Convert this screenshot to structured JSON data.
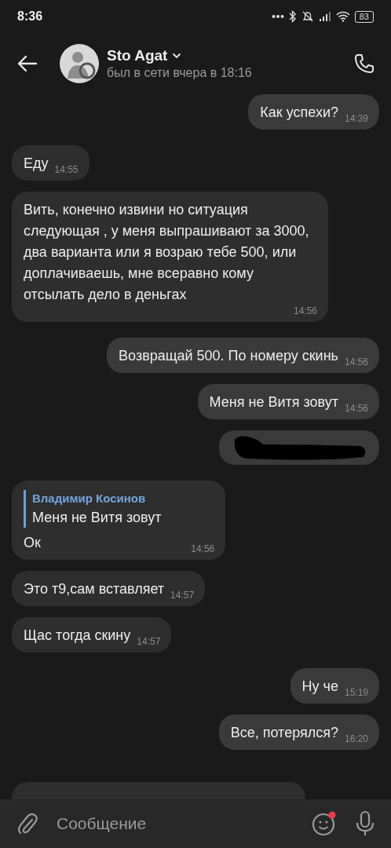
{
  "status_bar": {
    "time": "8:36",
    "battery": "83"
  },
  "header": {
    "name": "Sto Agat",
    "status": "был в сети вчера в 18:16"
  },
  "messages": [
    {
      "kind": "out",
      "text": "Как успехи?",
      "time": "14:39"
    },
    {
      "kind": "in",
      "text": "Еду",
      "time": "14:55"
    },
    {
      "kind": "in",
      "text": "Вить, конечно извини но ситуация следующая , у меня выпрашивают за 3000, два варианта или я возраю тебе 500, или доплачиваешь, мне всеравно кому отсылать дело  в деньгах",
      "time": "14:56"
    },
    {
      "kind": "out",
      "text": "Возвращай 500. По номеру скинь",
      "time": "14:56"
    },
    {
      "kind": "out",
      "text": "Меня не Витя зовут",
      "time": "14:56"
    },
    {
      "kind": "redacted"
    },
    {
      "kind": "in",
      "reply_author": "Владимир Косинов",
      "reply_text": "Меня не Витя зовут",
      "text": "Ок",
      "time": "14:56"
    },
    {
      "kind": "in",
      "text": "Это т9,сам вставляет",
      "time": "14:57"
    },
    {
      "kind": "in",
      "text": "Щас тогда скину",
      "time": "14:57"
    },
    {
      "kind": "out",
      "text": "Ну че",
      "time": "15:19"
    },
    {
      "kind": "out",
      "text": "Все, потерялся?",
      "time": "16:20"
    },
    {
      "kind": "partial"
    }
  ],
  "composer": {
    "placeholder": "Сообщение",
    "emoji_notification": true
  }
}
